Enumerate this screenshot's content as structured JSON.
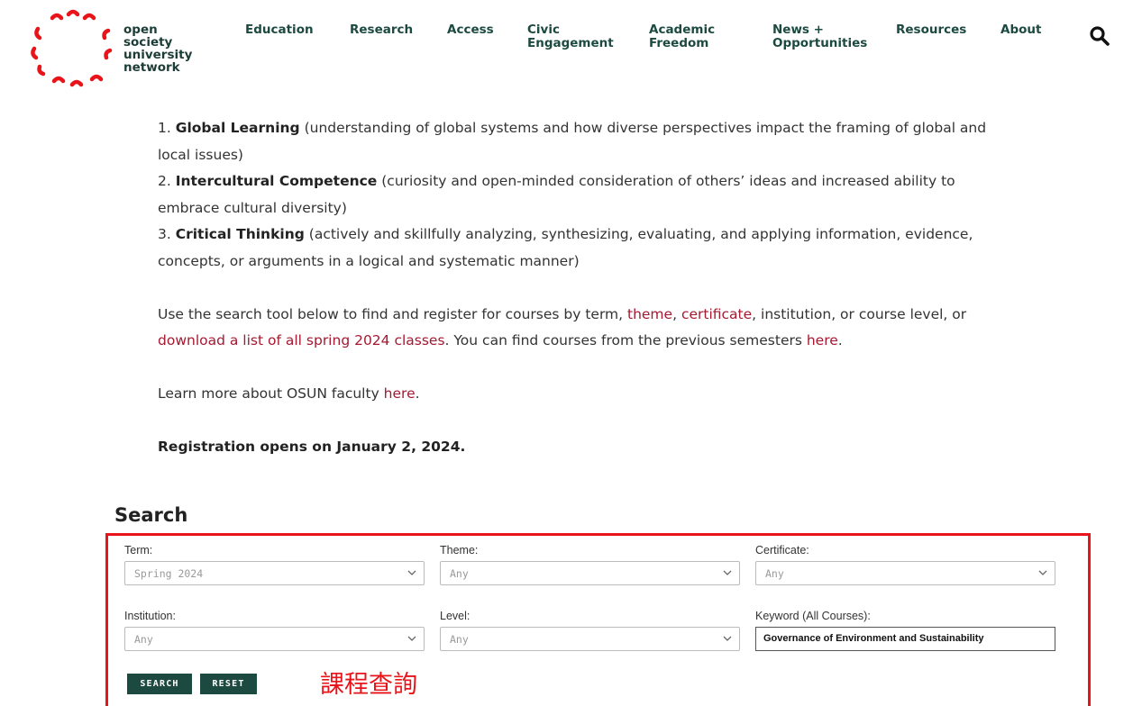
{
  "brand": {
    "name_lines": [
      "open",
      "society",
      "university",
      "network"
    ],
    "accent_color": "#e8141a",
    "nav_color": "#1c4a40"
  },
  "nav": [
    {
      "lines": [
        "Education"
      ]
    },
    {
      "lines": [
        "Research"
      ]
    },
    {
      "lines": [
        "Access"
      ]
    },
    {
      "lines": [
        "Civic",
        "Engagement"
      ]
    },
    {
      "lines": [
        "Academic",
        "Freedom"
      ]
    },
    {
      "lines": [
        "News +",
        "Opportunities"
      ]
    },
    {
      "lines": [
        "Resources"
      ]
    },
    {
      "lines": [
        "About"
      ]
    }
  ],
  "header": {
    "search_icon": "search-icon"
  },
  "content": {
    "item1_num": "1. ",
    "item1_bold": "Global Learning",
    "item1_rest_a": " (understanding of global systems and how diverse perspectives impact the framing of global and",
    "item1_rest_b": "local issues)",
    "item2_num": "2. ",
    "item2_bold": "Intercultural Competence",
    "item2_rest_a": " (curiosity and open-minded consideration of others’ ideas and increased ability to",
    "item2_rest_b": "embrace cultural diversity)",
    "item3_num": "3. ",
    "item3_bold": "Critical Thinking",
    "item3_rest_a": " (actively and skillfully analyzing, synthesizing, evaluating, and applying information, evidence,",
    "item3_rest_b": "concepts, or arguments in a logical and systematic manner)",
    "p2_a": "Use the search tool below to find and register for courses by term, ",
    "p2_link_theme": "theme",
    "p2_comma": ", ",
    "p2_link_certificate": "certificate",
    "p2_b": ", institution, or course level, or",
    "p2_link_download": "download a list of all spring 2024 classes",
    "p2_c": ". You can find courses from the previous semesters ",
    "p2_link_here": "here",
    "p2_end": ".",
    "p3_a": "Learn more about OSUN faculty ",
    "p3_link_here": "here",
    "p3_end": ".",
    "registration": "Registration opens on January 2, 2024."
  },
  "search": {
    "heading": "Search",
    "term_label": "Term:",
    "term_value": "Spring 2024",
    "theme_label": "Theme:",
    "theme_value": "Any",
    "certificate_label": "Certificate:",
    "certificate_value": "Any",
    "institution_label": "Institution:",
    "institution_value": "Any",
    "level_label": "Level:",
    "level_value": "Any",
    "keyword_label": "Keyword (All Courses):",
    "keyword_value": "Governance of Environment and Sustainability",
    "search_button": "SEARCH",
    "reset_button": "RESET"
  },
  "annotation": "課程查詢"
}
